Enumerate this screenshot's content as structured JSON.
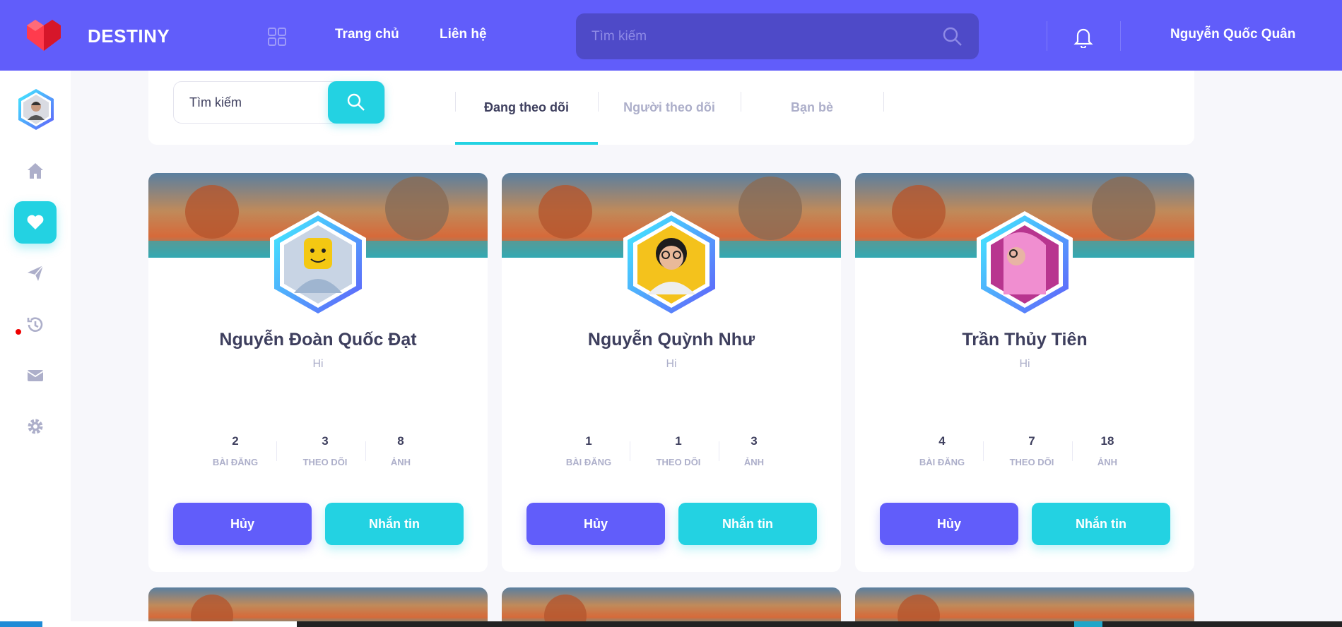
{
  "app": {
    "brand": "DESTINY"
  },
  "header": {
    "nav": [
      {
        "label": "Trang chủ"
      },
      {
        "label": "Liên hệ"
      }
    ],
    "search": {
      "placeholder": "Tìm kiếm",
      "value": ""
    },
    "user_name": "Nguyễn Quốc Quân"
  },
  "sidebar": {
    "items": [
      {
        "icon": "home-icon",
        "active": false
      },
      {
        "icon": "heart-icon",
        "active": true
      },
      {
        "icon": "send-icon",
        "active": false,
        "notification": true
      },
      {
        "icon": "history-icon",
        "active": false
      },
      {
        "icon": "mail-icon",
        "active": false
      },
      {
        "icon": "gear-icon",
        "active": false
      }
    ]
  },
  "filter": {
    "search": {
      "placeholder": "Tìm kiếm",
      "value": ""
    },
    "tabs": [
      {
        "label": "Đang theo dõi",
        "active": true
      },
      {
        "label": "Người theo dõi",
        "active": false
      },
      {
        "label": "Bạn bè",
        "active": false
      }
    ]
  },
  "cards": [
    {
      "name": "Nguyễn Đoàn Quốc Đạt",
      "bio": "Hi",
      "stats": [
        {
          "value": "2",
          "label": "BÀI ĐĂNG"
        },
        {
          "value": "3",
          "label": "THEO DÕI"
        },
        {
          "value": "8",
          "label": "ẢNH"
        }
      ],
      "cancel_label": "Hủy",
      "message_label": "Nhắn tin"
    },
    {
      "name": "Nguyễn Quỳnh Như",
      "bio": "Hi",
      "stats": [
        {
          "value": "1",
          "label": "BÀI ĐĂNG"
        },
        {
          "value": "1",
          "label": "THEO DÕI"
        },
        {
          "value": "3",
          "label": "ẢNH"
        }
      ],
      "cancel_label": "Hủy",
      "message_label": "Nhắn tin"
    },
    {
      "name": "Trần Thủy Tiên",
      "bio": "Hi",
      "stats": [
        {
          "value": "4",
          "label": "BÀI ĐĂNG"
        },
        {
          "value": "7",
          "label": "THEO DÕI"
        },
        {
          "value": "18",
          "label": "ẢNH"
        }
      ],
      "cancel_label": "Hủy",
      "message_label": "Nhắn tin"
    }
  ],
  "colors": {
    "primary": "#615dfa",
    "secondary": "#23d2e2",
    "text_dark": "#3e3f5e",
    "text_muted": "#adafca"
  }
}
